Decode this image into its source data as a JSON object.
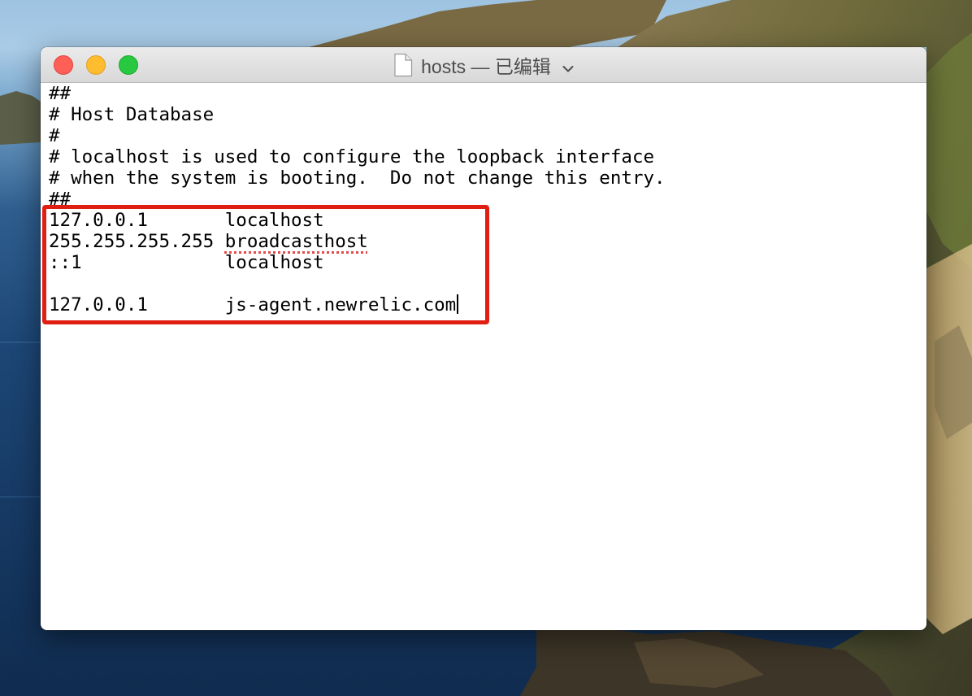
{
  "window": {
    "title": "hosts — 已编辑",
    "controls": {
      "close": "close-button",
      "minimize": "minimize-button",
      "zoom": "zoom-button"
    },
    "icons": {
      "document": "document-icon",
      "title_menu": "chevron-down-icon"
    }
  },
  "editor": {
    "lines": [
      "##",
      "# Host Database",
      "#",
      "# localhost is used to configure the loopback interface",
      "# when the system is booting.  Do not change this entry.",
      "##",
      "127.0.0.1       localhost",
      "255.255.255.255 ",
      "::1             localhost",
      "",
      "127.0.0.1       js-agent.newrelic.com"
    ],
    "misspelled_word": "broadcasthost",
    "caret_line": 11
  },
  "annotation": {
    "highlight_color": "#e01e12"
  },
  "colors": {
    "close": "#fe5f57",
    "minimize": "#febc2e",
    "zoom": "#28c840"
  }
}
